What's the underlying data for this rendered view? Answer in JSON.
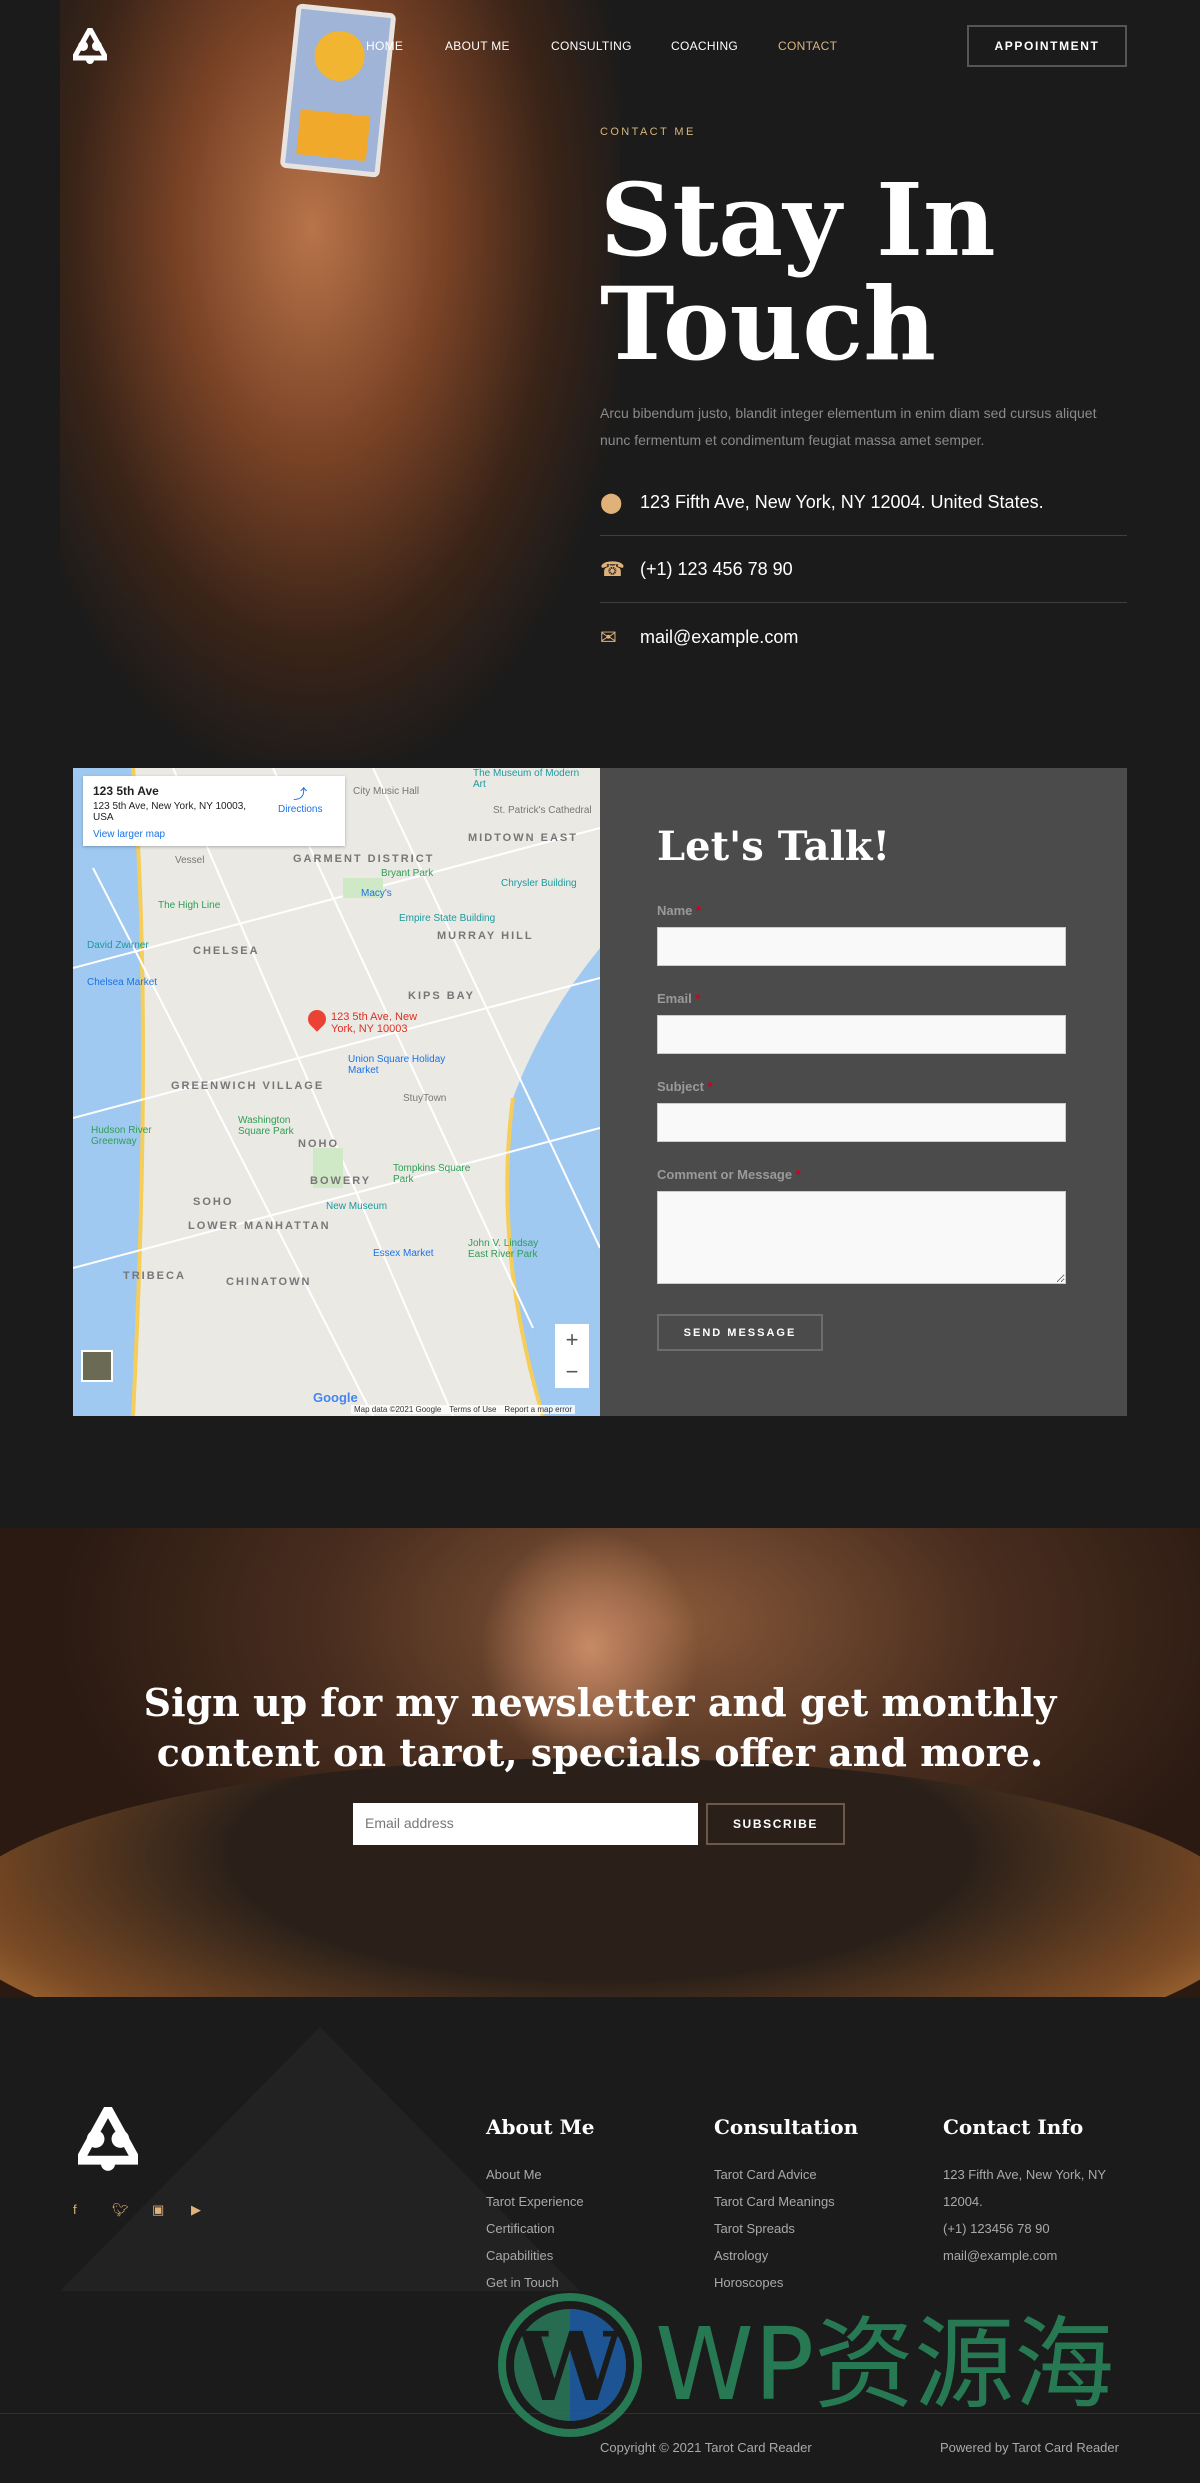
{
  "colors": {
    "accent": "#e0b27a",
    "background": "#1b1b1b",
    "form_panel": "#4b4b4b",
    "required": "#d0021b"
  },
  "nav": {
    "logo": "tarot-triangle-logo",
    "items": [
      {
        "label": "HOME"
      },
      {
        "label": "ABOUT ME"
      },
      {
        "label": "CONSULTING"
      },
      {
        "label": "COACHING"
      },
      {
        "label": "CONTACT",
        "active": true
      }
    ],
    "appointment": "APPOINTMENT"
  },
  "hero": {
    "eyebrow": "CONTACT ME",
    "title_line1": "Stay In",
    "title_line2": "Touch",
    "intro": "Arcu bibendum justo, blandit integer elementum in enim diam sed cursus aliquet nunc fermentum et condimentum feugiat massa amet semper.",
    "address": "123 Fifth Ave, New York, NY 12004. United States.",
    "phone": "(+1) 123 456 78 90",
    "email": "mail@example.com"
  },
  "map": {
    "place_title": "123 5th Ave",
    "place_address": "123 5th Ave, New York, NY 10003, USA",
    "directions": "Directions",
    "view_larger": "View larger map",
    "pin_label": "123 5th Ave, New York, NY 10003",
    "labels": [
      "GARMENT DISTRICT",
      "MIDTOWN EAST",
      "CHELSEA",
      "MURRAY HILL",
      "KIPS BAY",
      "GREENWICH VILLAGE",
      "NOHO",
      "BOWERY",
      "SOHO",
      "LOWER MANHATTAN",
      "TRIBECA",
      "CHINATOWN"
    ],
    "places": [
      "The Museum of Modern Art",
      "City Music Hall",
      "St. Patrick's Cathedral",
      "Bryant Park",
      "Macy's",
      "Chrysler Building",
      "Empire State Building",
      "The High Line",
      "David Zwirner",
      "Chelsea Market",
      "Union Square Holiday Market",
      "StuyTown",
      "Washington Square Park",
      "Hudson River Greenway",
      "Tompkins Square Park",
      "New Museum",
      "Essex Market",
      "John V. Lindsay East River Park",
      "Vessel"
    ],
    "attribution": "Map data ©2021 Google",
    "terms": "Terms of Use",
    "report": "Report a map error",
    "google": "Google",
    "zoom_in": "+",
    "zoom_out": "−"
  },
  "form": {
    "title": "Let's Talk!",
    "name_label": "Name",
    "email_label": "Email",
    "subject_label": "Subject",
    "message_label": "Comment or Message",
    "required_mark": "*",
    "send": "SEND MESSAGE"
  },
  "newsletter": {
    "title": "Sign up for my newsletter and get monthly content on tarot, specials offer and more.",
    "email_placeholder": "Email address",
    "subscribe": "SUBSCRIBE"
  },
  "footer": {
    "social": [
      "facebook",
      "twitter",
      "instagram",
      "youtube"
    ],
    "about": {
      "title": "About Me",
      "links": [
        "About Me",
        "Tarot Experience",
        "Certification",
        "Capabilities",
        "Get in Touch"
      ]
    },
    "consultation": {
      "title": "Consultation",
      "links": [
        "Tarot Card Advice",
        "Tarot Card Meanings",
        "Tarot Spreads",
        "Astrology",
        "Horoscopes"
      ]
    },
    "contact": {
      "title": "Contact Info",
      "lines": [
        "123 Fifth Ave, New York, NY",
        "12004.",
        "(+1) 123456 78 90",
        "mail@example.com"
      ]
    },
    "copyright": "Copyright © 2021 Tarot Card Reader",
    "powered": "Powered by Tarot Card Reader"
  },
  "watermark": {
    "text": "WP资源海"
  }
}
